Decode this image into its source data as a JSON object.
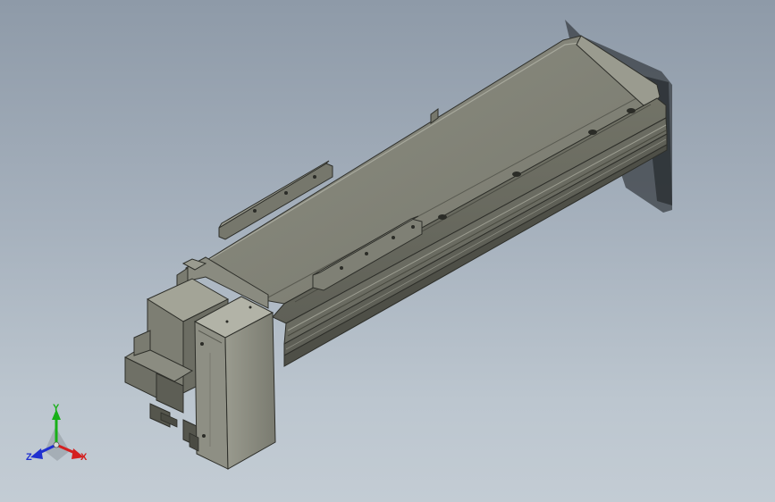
{
  "viewport": {
    "background_top": "#8e9aa8",
    "background_bottom": "#c3ccd4",
    "model": "linear-actuator-module"
  },
  "triad": {
    "x_label": "X",
    "y_label": "Y",
    "z_label": "Z",
    "x_color": "#d42020",
    "y_color": "#18b018",
    "z_color": "#2030d0"
  },
  "colors": {
    "body_top": "#7e7f74",
    "body_front": "#6b6c62",
    "body_side": "#8a8b80",
    "edge": "#2e2f2a",
    "highlight": "#a7a89c"
  }
}
